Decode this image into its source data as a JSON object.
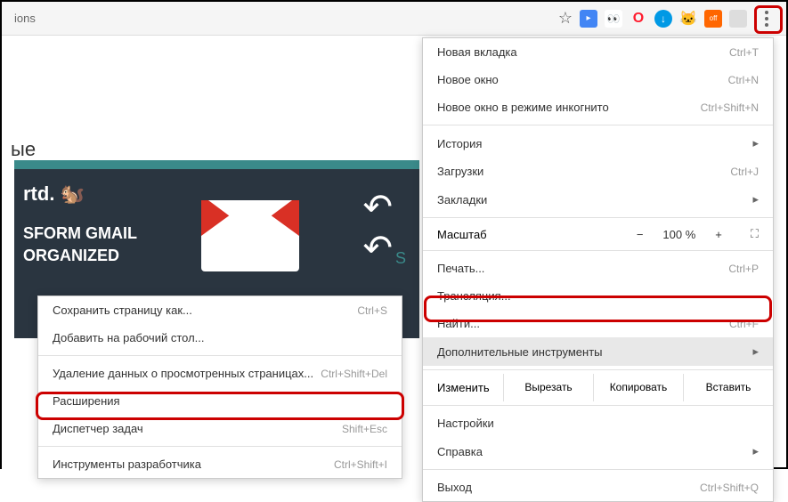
{
  "url": "ions",
  "banner": {
    "logo": "rtd.",
    "line1": "SFORM GMAIL",
    "line2": "ORGANIZED"
  },
  "page_text": "ые",
  "menu": {
    "new_tab": "Новая вкладка",
    "new_tab_sc": "Ctrl+T",
    "new_window": "Новое окно",
    "new_window_sc": "Ctrl+N",
    "incognito": "Новое окно в режиме инкогнито",
    "incognito_sc": "Ctrl+Shift+N",
    "history": "История",
    "downloads": "Загрузки",
    "downloads_sc": "Ctrl+J",
    "bookmarks": "Закладки",
    "zoom": "Масштаб",
    "zoom_minus": "−",
    "zoom_value": "100 %",
    "zoom_plus": "+",
    "print": "Печать...",
    "print_sc": "Ctrl+P",
    "cast": "Трансляция...",
    "find": "Найти...",
    "find_sc": "Ctrl+F",
    "more_tools": "Дополнительные инструменты",
    "edit": "Изменить",
    "cut": "Вырезать",
    "copy": "Копировать",
    "paste": "Вставить",
    "settings": "Настройки",
    "help": "Справка",
    "exit": "Выход",
    "exit_sc": "Ctrl+Shift+Q"
  },
  "submenu": {
    "save_page": "Сохранить страницу как...",
    "save_page_sc": "Ctrl+S",
    "add_desktop": "Добавить на рабочий стол...",
    "clear_data": "Удаление данных о просмотренных страницах...",
    "clear_data_sc": "Ctrl+Shift+Del",
    "extensions": "Расширения",
    "task_manager": "Диспетчер задач",
    "task_manager_sc": "Shift+Esc",
    "dev_tools": "Инструменты разработчика",
    "dev_tools_sc": "Ctrl+Shift+I"
  }
}
